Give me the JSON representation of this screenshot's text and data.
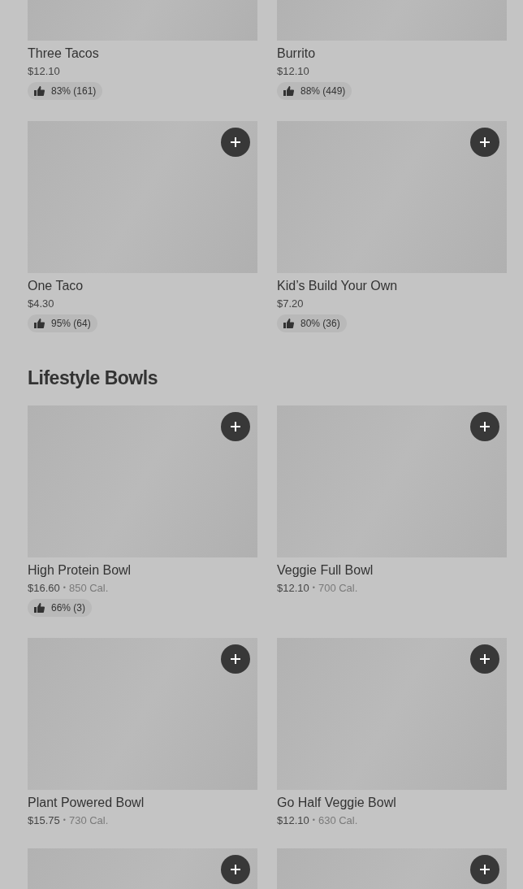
{
  "sections": [
    {
      "items": [
        {
          "name": "Three Tacos",
          "price": "$12.10",
          "rating": "83% (161)",
          "add_button": false
        },
        {
          "name": "Burrito",
          "price": "$12.10",
          "rating": "88% (449)",
          "add_button": false
        },
        {
          "name": "One Taco",
          "price": "$4.30",
          "rating": "95% (64)",
          "add_button": true
        },
        {
          "name": "Kid’s Build Your Own",
          "price": "$7.20",
          "rating": "80% (36)",
          "add_button": true
        }
      ]
    },
    {
      "title": "Lifestyle Bowls",
      "items": [
        {
          "name": "High Protein Bowl",
          "price": "$16.60",
          "separator": "•",
          "calories": "850 Cal.",
          "rating": "66% (3)",
          "add_button": true
        },
        {
          "name": "Veggie Full Bowl",
          "price": "$12.10",
          "separator": "•",
          "calories": "700 Cal.",
          "add_button": true
        },
        {
          "name": "Plant Powered Bowl",
          "price": "$15.75",
          "separator": "•",
          "calories": "730 Cal.",
          "add_button": true
        },
        {
          "name": "Go Half Veggie Bowl",
          "price": "$12.10",
          "separator": "•",
          "calories": "630 Cal.",
          "add_button": true
        },
        {
          "add_button": true
        },
        {
          "add_button": true
        }
      ]
    }
  ]
}
